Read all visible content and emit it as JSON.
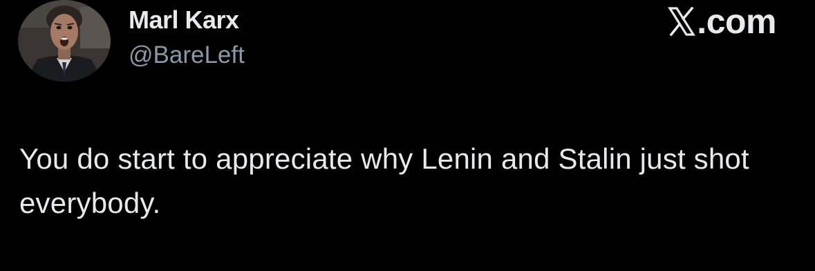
{
  "author": {
    "display_name": "Marl Karx",
    "handle": "@BareLeft",
    "avatar_icon": "profile-photo-shouting-man"
  },
  "brand": {
    "label": ".com",
    "icon": "x-logo-icon"
  },
  "tweet": {
    "text": "You do start to appreciate why Lenin and Stalin just shot everybody."
  },
  "colors": {
    "background": "#000000",
    "primary_text": "#e7e9ea",
    "secondary_text": "#8b98a5"
  }
}
